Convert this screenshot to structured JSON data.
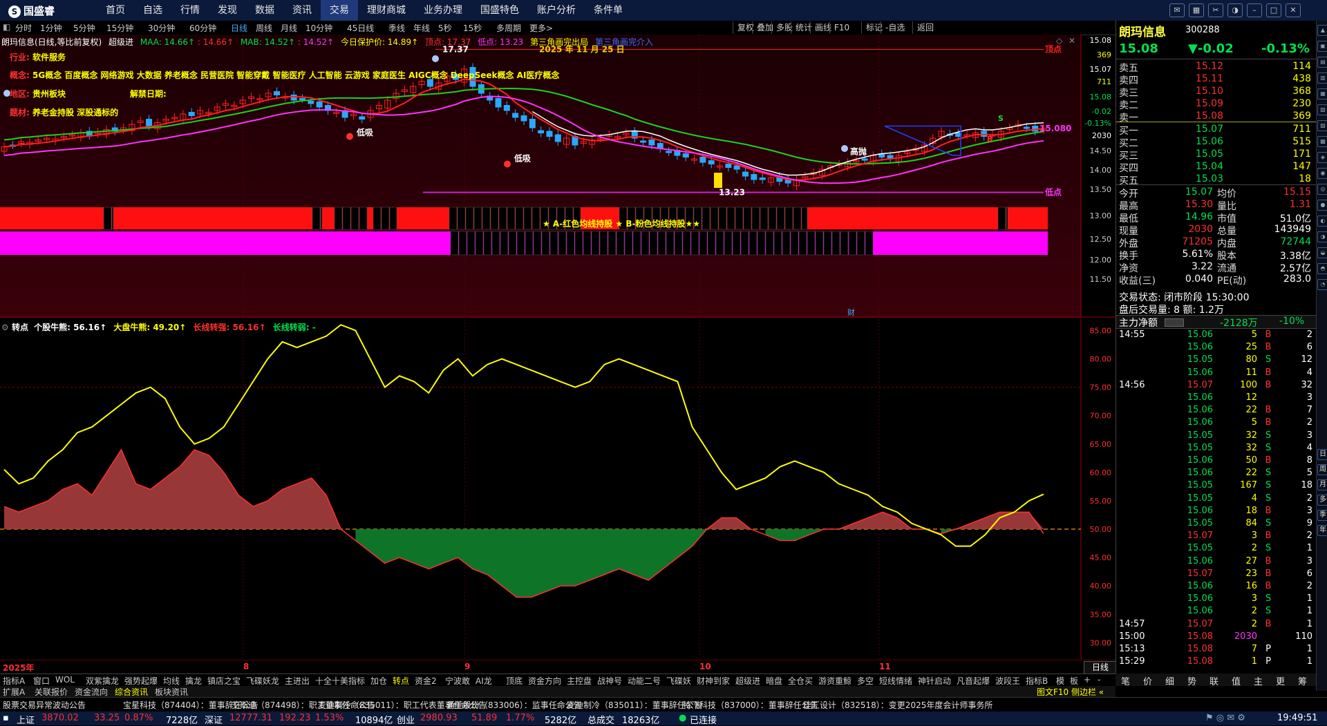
{
  "app": {
    "name": "国盛睿",
    "menu": [
      "首页",
      "自选",
      "行情",
      "发现",
      "数据",
      "资讯",
      "交易",
      "理财商城",
      "业务办理",
      "国盛特色",
      "账户分析",
      "条件单"
    ],
    "active_menu": "交易"
  },
  "timeframes": [
    "分时",
    "1分钟",
    "5分钟",
    "15分钟",
    "30分钟",
    "60分钟",
    "日线",
    "周线",
    "月线",
    "10分钟",
    "45日线",
    "季线",
    "年线",
    "5秒",
    "15秒",
    "多周期",
    "更多>"
  ],
  "active_timeframe": "日线",
  "toolbar_right": [
    "复权",
    "叠加",
    "多股",
    "统计",
    "画线",
    "F10",
    "标记",
    "-自选",
    "返回"
  ],
  "main_header": {
    "title": "朗玛信息(日线,等比前复权)",
    "indicator": "超级进",
    "maa_label": "MAA: 14.66↑",
    "maa2": ": 14.66↑",
    "mab_label": "MAB: 14.52↑",
    "mab2": ": 14.52↑",
    "stop": "今日保护价: 14.89↑",
    "top": "顶点: 17.37",
    "bottom": "低点: 13.23",
    "tri1": "第三角画完出局",
    "tri2": "第三角画完介入"
  },
  "stock_info": {
    "industry_label": "行业:",
    "industry": "软件服务",
    "concept_label": "概念:",
    "concepts": "5G概念 百度概念 网络游戏 大数据 养老概念 民营医院 智能穿戴 智能医疗 人工智能 云游戏 家庭医生 AIGC概念 DeepSeek概念 AI医疗概念",
    "region_label": "地区:",
    "region": "贵州板块",
    "lift_label": "解禁日期:",
    "focus_label": "题材:",
    "focus": "养老金持股 深股通标的"
  },
  "chart_annotations": {
    "high_price": "17.37",
    "low_price": "13.23",
    "date": "2025 年 11 月 25 日",
    "sell_low": "低吸",
    "sell_low2": "低吸",
    "high_throw": "高抛",
    "top_tag": "顶点",
    "bottom_tag": "低点",
    "last_price": "15.080",
    "band_text": "★ A-红色均线持股 ★ B-粉色均线持股★★",
    "fin_mark": "财",
    "s_mark": "S",
    "b_mark": "B"
  },
  "main_axis": {
    "labels": [
      "15.08",
      "369",
      "15.07",
      "711",
      "15.08",
      "-0.02",
      "-0.13%",
      "2030",
      "14.50",
      "14.00",
      "13.50",
      "13.00",
      "12.50",
      "12.00",
      "11.50"
    ],
    "ylim": [
      11.3,
      17.6
    ]
  },
  "sub_header": {
    "name": "转点",
    "stock_bull": "个股牛熊: 56.16↑",
    "market_bull": "大盘牛熊: 49.20↑",
    "long_turn_strong": "长线转强: 56.16↑",
    "long_turn_weak": "长线转弱: -"
  },
  "sub_axis": {
    "labels": [
      "85.00",
      "80.00",
      "75.00",
      "70.00",
      "65.00",
      "60.00",
      "55.00",
      "50.00",
      "45.00",
      "40.00",
      "35.00",
      "30.00"
    ],
    "ylim": [
      27,
      87
    ]
  },
  "x_axis": {
    "labels": [
      "2025年",
      "8",
      "9",
      "10",
      "11"
    ],
    "mode": "日线"
  },
  "chart_data": [
    {
      "type": "candlestick",
      "title": "朗玛信息(日线,等比前复权)",
      "ylim": [
        11.3,
        17.6
      ],
      "x": [
        "2025-07",
        "2025-08",
        "2025-09",
        "2025-10",
        "2025-11"
      ],
      "series": [
        {
          "name": "MAA",
          "last": 14.66
        },
        {
          "name": "MAB",
          "last": 14.52
        }
      ],
      "high": 17.37,
      "low": 13.23,
      "last_close": 15.08
    },
    {
      "type": "line",
      "title": "转点",
      "ylim": [
        27,
        87
      ],
      "series": [
        {
          "name": "个股牛熊",
          "values": [
            60.5,
            58,
            59,
            62,
            64,
            67,
            68,
            70,
            72,
            74,
            75,
            73,
            68,
            65,
            66,
            68,
            72,
            76,
            80,
            83,
            82,
            83,
            84,
            86,
            85,
            80,
            75,
            77,
            76,
            74,
            78,
            80,
            77,
            79,
            80,
            79,
            78,
            77,
            76,
            75,
            76,
            79,
            80,
            79,
            78,
            77,
            76,
            68,
            64,
            60,
            57,
            58,
            59,
            61,
            62,
            61,
            60,
            58,
            57,
            56,
            54,
            53,
            51,
            50,
            49,
            47,
            47,
            49,
            52,
            53,
            55,
            56.16
          ]
        },
        {
          "name": "大盘牛熊",
          "values": [
            54,
            53,
            54,
            55,
            57,
            58,
            56,
            60,
            64,
            58,
            57,
            59,
            61,
            64,
            63,
            60,
            56,
            54,
            55,
            57,
            58,
            59,
            56,
            50,
            48,
            46,
            44,
            45,
            44,
            43,
            44,
            45,
            43,
            42,
            40,
            38,
            38,
            39,
            40,
            40,
            41,
            42,
            43,
            42,
            41,
            43,
            45,
            47,
            50,
            52,
            52,
            50,
            49,
            48,
            48,
            49,
            50,
            50,
            51,
            52,
            53,
            52,
            50,
            50,
            49.2,
            50,
            51,
            52,
            53,
            53,
            53,
            49.2
          ]
        },
        {
          "name": "长线转强",
          "values": [
            56.16
          ]
        }
      ],
      "reference_line": 50
    }
  ],
  "quote": {
    "name": "朗玛信息",
    "code": "300288",
    "price": "15.08",
    "change": "▼-0.02",
    "pct": "-0.13%",
    "asks": [
      {
        "label": "卖五",
        "price": "15.12",
        "vol": "114"
      },
      {
        "label": "卖四",
        "price": "15.11",
        "vol": "438"
      },
      {
        "label": "卖三",
        "price": "15.10",
        "vol": "368"
      },
      {
        "label": "卖二",
        "price": "15.09",
        "vol": "230"
      },
      {
        "label": "卖一",
        "price": "15.08",
        "vol": "369"
      }
    ],
    "bids": [
      {
        "label": "买一",
        "price": "15.07",
        "vol": "711"
      },
      {
        "label": "买二",
        "price": "15.06",
        "vol": "515"
      },
      {
        "label": "买三",
        "price": "15.05",
        "vol": "171"
      },
      {
        "label": "买四",
        "price": "15.04",
        "vol": "147"
      },
      {
        "label": "买五",
        "price": "15.03",
        "vol": "18"
      }
    ],
    "stats": [
      {
        "l1": "今开",
        "v1": "15.07",
        "l2": "均价",
        "v2": "15.15"
      },
      {
        "l1": "最高",
        "v1": "15.30",
        "l2": "量比",
        "v2": "1.31"
      },
      {
        "l1": "最低",
        "v1": "14.96",
        "l2": "市值",
        "v2": "51.0亿"
      },
      {
        "l1": "现量",
        "v1": "2030",
        "l2": "总量",
        "v2": "143949"
      },
      {
        "l1": "外盘",
        "v1": "71205",
        "l2": "内盘",
        "v2": "72744"
      },
      {
        "l1": "换手",
        "v1": "5.61%",
        "l2": "股本",
        "v2": "3.38亿"
      },
      {
        "l1": "净资",
        "v1": "3.22",
        "l2": "流通",
        "v2": "2.57亿"
      },
      {
        "l1": "收益(三)",
        "v1": "0.040",
        "l2": "PE(动)",
        "v2": "283.0"
      }
    ],
    "trade_state": "交易状态: 闭市阶段 15:30:00",
    "after_hours": "盘后交易量: 8  额: 1.2万",
    "main_net_label": "主力净额",
    "main_net_value": "-2128万",
    "main_net_pct": "-10%"
  },
  "ticks": [
    {
      "t": "14:55",
      "p": "15.06",
      "v": "5",
      "d": "B",
      "n": "2"
    },
    {
      "t": "",
      "p": "15.06",
      "v": "25",
      "d": "B",
      "n": "6"
    },
    {
      "t": "",
      "p": "15.05",
      "v": "80",
      "d": "S",
      "n": "12"
    },
    {
      "t": "",
      "p": "15.06",
      "v": "11",
      "d": "B",
      "n": "4"
    },
    {
      "t": "14:56",
      "p": "15.07",
      "v": "100",
      "d": "B",
      "n": "32"
    },
    {
      "t": "",
      "p": "15.06",
      "v": "12",
      "d": "",
      "n": "3"
    },
    {
      "t": "",
      "p": "15.06",
      "v": "22",
      "d": "B",
      "n": "7"
    },
    {
      "t": "",
      "p": "15.06",
      "v": "5",
      "d": "B",
      "n": "2"
    },
    {
      "t": "",
      "p": "15.05",
      "v": "32",
      "d": "S",
      "n": "3"
    },
    {
      "t": "",
      "p": "15.05",
      "v": "32",
      "d": "S",
      "n": "4"
    },
    {
      "t": "",
      "p": "15.06",
      "v": "50",
      "d": "B",
      "n": "8"
    },
    {
      "t": "",
      "p": "15.06",
      "v": "22",
      "d": "S",
      "n": "5"
    },
    {
      "t": "",
      "p": "15.05",
      "v": "167",
      "d": "S",
      "n": "18"
    },
    {
      "t": "",
      "p": "15.05",
      "v": "4",
      "d": "S",
      "n": "2"
    },
    {
      "t": "",
      "p": "15.06",
      "v": "18",
      "d": "B",
      "n": "3"
    },
    {
      "t": "",
      "p": "15.05",
      "v": "84",
      "d": "S",
      "n": "9"
    },
    {
      "t": "",
      "p": "15.07",
      "v": "3",
      "d": "B",
      "n": "2"
    },
    {
      "t": "",
      "p": "15.05",
      "v": "2",
      "d": "S",
      "n": "1"
    },
    {
      "t": "",
      "p": "15.06",
      "v": "27",
      "d": "B",
      "n": "3"
    },
    {
      "t": "",
      "p": "15.07",
      "v": "23",
      "d": "B",
      "n": "6"
    },
    {
      "t": "",
      "p": "15.06",
      "v": "16",
      "d": "B",
      "n": "2"
    },
    {
      "t": "",
      "p": "15.06",
      "v": "3",
      "d": "S",
      "n": "1"
    },
    {
      "t": "",
      "p": "15.06",
      "v": "2",
      "d": "S",
      "n": "1"
    },
    {
      "t": "14:57",
      "p": "15.07",
      "v": "2",
      "d": "B",
      "n": "1"
    },
    {
      "t": "15:00",
      "p": "15.08",
      "v": "2030",
      "d": "",
      "n": "110"
    },
    {
      "t": "15:13",
      "p": "15.08",
      "v": "7",
      "d": "P",
      "n": "1"
    },
    {
      "t": "15:29",
      "p": "15.08",
      "v": "1",
      "d": "P",
      "n": "1"
    }
  ],
  "right_tabs": [
    "笔",
    "价",
    "细",
    "势",
    "联",
    "值",
    "主",
    "更",
    "筹"
  ],
  "side_icons": [
    "日",
    "周",
    "月",
    "多",
    "季",
    "年"
  ],
  "indicator_tabs": [
    "指标A",
    "窗口",
    "WOL",
    "双紫擒龙",
    "强势起爆",
    "均线",
    "擒龙",
    "镇店之宝",
    "飞碟妖龙",
    "主进出",
    "十全十美指标",
    "加仓",
    "转点",
    "资金2",
    "宁波敢",
    "AI龙",
    "顶底",
    "资金方向",
    "主控盘",
    "战神号",
    "动能二号",
    "飞碟妖",
    "财神到家",
    "超级进",
    "暗盘",
    "全仓买",
    "游资重鲸",
    "多空",
    "短线情绪",
    "神针启动",
    "凡音起爆",
    "波段王",
    "指标B",
    "模",
    "板",
    "+",
    "-"
  ],
  "selected_indicator": "转点",
  "sub_tabs": [
    "扩展A",
    "关联报价",
    "资金流向",
    "综合资讯",
    "板块资讯"
  ],
  "selected_sub_tab": "综合资讯",
  "sub_right": "图文F10 侧边栏 «",
  "news": [
    "股票交易异常波动公告",
    "宝星科技（874404）：董事辞任公告",
    "艾斯迪（874498）：职工董事任命公告",
    "麦迪制冷（835011）：职工代表董事任命公告",
    "通莞股份（833006）：监事任命公告",
    "麦迪制冷（835011）：董事辞任公告",
    "特飞科技（837000）：董事辞任公告",
    "佳汇设计（832518）：变更2025年度会计师事务所"
  ],
  "status": {
    "sh_label": "上证",
    "sh_val": "3870.02",
    "sh_chg": "33.25",
    "sh_pct": "0.87%",
    "sh_amt": "7228亿",
    "sz_label": "深证",
    "sz_val": "12777.31",
    "sz_chg": "192.23",
    "sz_pct": "1.53%",
    "sz_amt": "10894亿",
    "cy_label": "创业",
    "cy_val": "2980.93",
    "cy_chg": "51.89",
    "cy_pct": "1.77%",
    "cy_amt": "5282亿",
    "total_label": "总成交",
    "total": "18263亿",
    "conn": "已连接",
    "time": "19:49:51"
  },
  "colors": {
    "up": "#ff3030",
    "down": "#00e050",
    "bg": "#000000",
    "chart_bg_top": "#2a0006",
    "maa": "#ff2020",
    "mab": "#ff33ff",
    "white_ma": "#ffffff",
    "green_ma": "#20d020",
    "band_red": "#ff1010",
    "band_magenta": "#ff00ff",
    "yellow": "#ffff00"
  }
}
